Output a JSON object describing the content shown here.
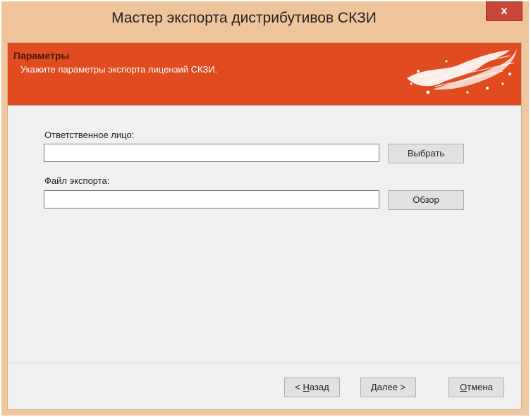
{
  "window": {
    "title": "Мастер экспорта дистрибутивов СКЗИ",
    "close_icon": "close-icon",
    "close_glyph": "x"
  },
  "banner": {
    "title": "Параметры",
    "subtitle": "Укажите параметры экспорта лицензий СКЗИ.",
    "colors": {
      "background": "#e04b1f",
      "title": "#4a1a0a",
      "subtitle": "#ffffff"
    }
  },
  "form": {
    "responsible_label": "Ответственное лицо:",
    "responsible_value": "",
    "select_button": "Выбрать",
    "export_file_label": "Файл экспорта:",
    "export_file_value": "",
    "browse_button": "Обзор"
  },
  "footer": {
    "back": {
      "accel": "Н",
      "rest": "азад",
      "prefix": "< "
    },
    "next": {
      "accel": "Д",
      "rest": "алее >"
    },
    "cancel": {
      "accel": "О",
      "rest": "тмена"
    }
  }
}
